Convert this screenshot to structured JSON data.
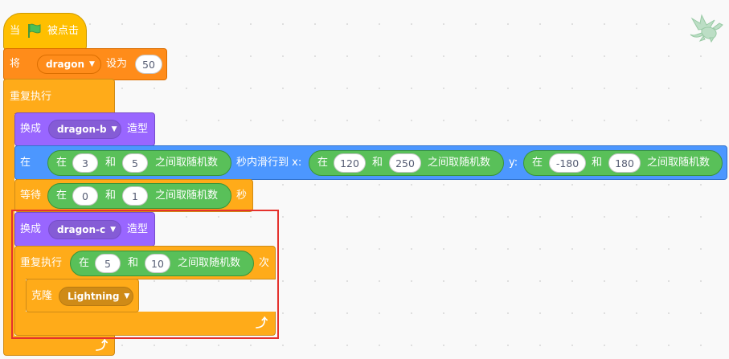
{
  "colors": {
    "events": "#ffbf00",
    "variables": "#ff8c1a",
    "control": "#ffab19",
    "looks": "#9966ff",
    "motion": "#4c97ff",
    "operators": "#59c059",
    "highlight": "#e5322d"
  },
  "hat": {
    "prefix": "当",
    "flag_icon": "green-flag-icon",
    "suffix": "被点击"
  },
  "set_var": {
    "prefix": "将",
    "var_name": "dragon",
    "middle": "设为",
    "value": "50"
  },
  "forever": {
    "label": "重复执行",
    "loop_icon": "loop-arrow-icon"
  },
  "switch_b": {
    "prefix": "换成",
    "costume": "dragon-b",
    "suffix": "造型"
  },
  "glide": {
    "prefix": "在",
    "time": {
      "pre": "在",
      "a": "3",
      "and": "和",
      "b": "5",
      "post": "之间取随机数"
    },
    "middle": "秒内滑行到 x:",
    "x": {
      "pre": "在",
      "a": "120",
      "and": "和",
      "b": "250",
      "post": "之间取随机数"
    },
    "y_label": "y:",
    "y": {
      "pre": "在",
      "a": "-180",
      "and": "和",
      "b": "180",
      "post": "之间取随机数"
    }
  },
  "wait": {
    "prefix": "等待",
    "rand": {
      "pre": "在",
      "a": "0",
      "and": "和",
      "b": "1",
      "post": "之间取随机数"
    },
    "suffix": "秒"
  },
  "switch_c": {
    "prefix": "换成",
    "costume": "dragon-c",
    "suffix": "造型"
  },
  "repeat": {
    "prefix": "重复执行",
    "rand": {
      "pre": "在",
      "a": "5",
      "and": "和",
      "b": "10",
      "post": "之间取随机数"
    },
    "suffix": "次",
    "loop_icon": "loop-arrow-icon"
  },
  "clone": {
    "prefix": "克隆",
    "target": "Lightning"
  },
  "sprite_thumbnail_icon": "dragon-sprite-icon"
}
